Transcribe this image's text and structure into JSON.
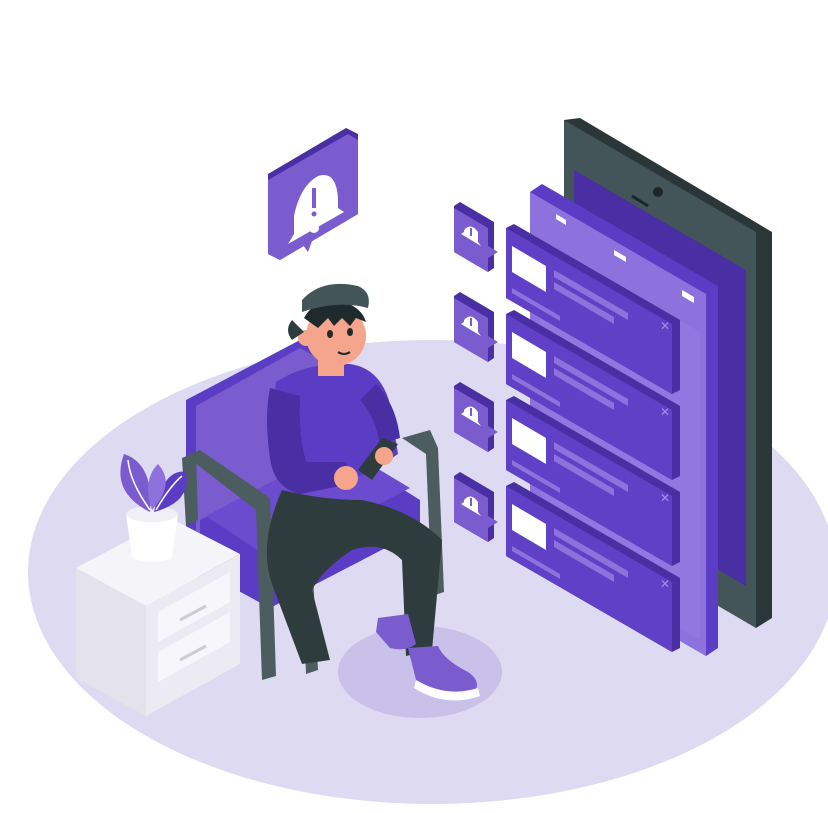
{
  "illustration": {
    "icons": [
      "bell-alert-icon",
      "close-icon",
      "signal-icon",
      "wifi-icon",
      "battery-icon"
    ],
    "colors": {
      "primary": "#7a5ccf",
      "primary_dark": "#5b3cc4",
      "primary_deep": "#4a2ea3",
      "floor": "#dedaf2",
      "phone_body": "#3a4a4c",
      "pants": "#2f3c3d",
      "skin": "#f5a58c",
      "white": "#ffffff",
      "furniture": "#eceaf2"
    },
    "notifications": [
      {
        "title": "",
        "body": ""
      },
      {
        "title": "",
        "body": ""
      },
      {
        "title": "",
        "body": ""
      },
      {
        "title": "",
        "body": ""
      }
    ]
  }
}
